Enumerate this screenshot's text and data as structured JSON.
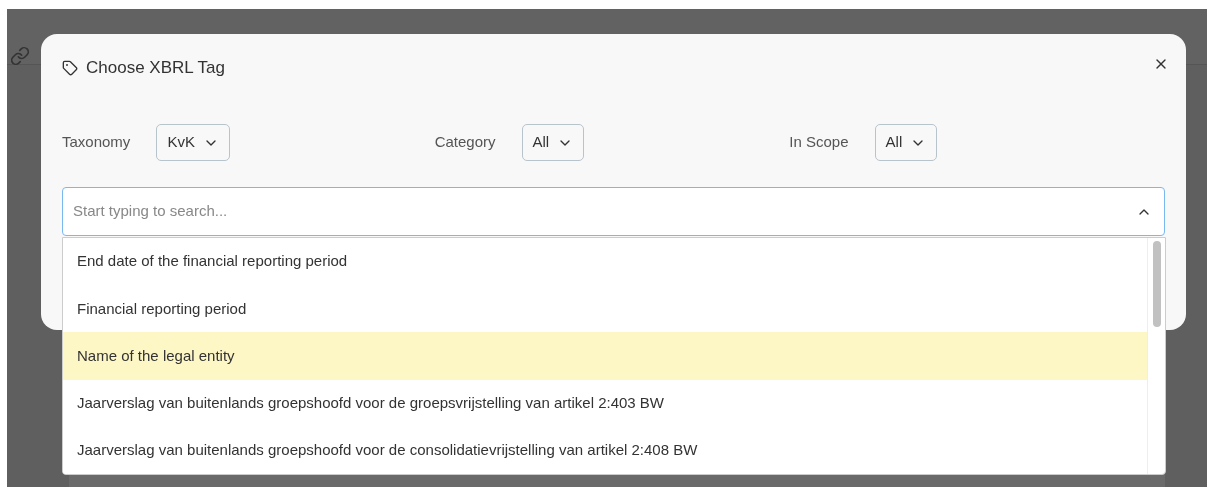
{
  "dialog": {
    "title": "Choose XBRL Tag",
    "filters": [
      {
        "label": "Taxonomy",
        "value": "KvK"
      },
      {
        "label": "Category",
        "value": "All"
      },
      {
        "label": "In Scope",
        "value": "All"
      }
    ],
    "search": {
      "placeholder": "Start typing to search...",
      "expanded": true
    },
    "options": [
      {
        "label": "End date of the financial reporting period",
        "selected": false
      },
      {
        "label": "Financial reporting period",
        "selected": false
      },
      {
        "label": "Name of the legal entity",
        "selected": true
      },
      {
        "label": "Jaarverslag van buitenlands groepshoofd voor de groepsvrijstelling van artikel 2:403 BW",
        "selected": false
      },
      {
        "label": "Jaarverslag van buitenlands groepshoofd voor de consolidatievrijstelling van artikel 2:408 BW",
        "selected": false
      }
    ]
  }
}
